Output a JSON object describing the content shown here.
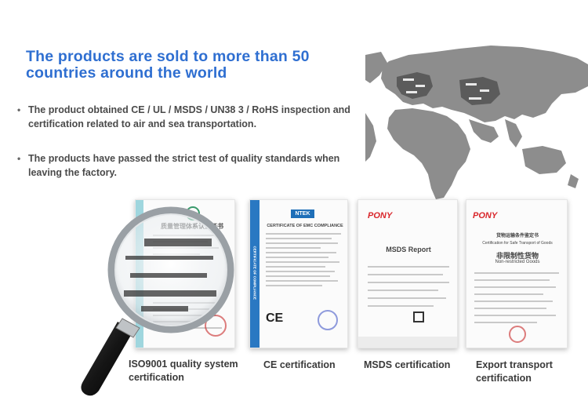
{
  "headline": "The products are sold to more than 50 countries around the world",
  "bullets": [
    "The product obtained CE / UL / MSDS / UN38 3 / RoHS inspection and certification related to air and sea transportation.",
    "The products have passed the strict test of quality standards when leaving the factory."
  ],
  "bullet_symbol": "•",
  "certificates": [
    {
      "caption": "ISO9001 quality system certification",
      "doc_title": "质量管理体系认证证书",
      "doc_lines": [
        "科技有限公司",
        "注册地址：",
        "代码: 9144030005276516",
        "质量管理体系符合",
        "1-2008 idt ISO9001: 2008 标准",
        "证书覆盖范",
        "：惠子电池的生产"
      ]
    },
    {
      "caption": "CE certification",
      "brand": "NTEK",
      "doc_title": "CERTIFICATE OF EMC COMPLIANCE",
      "side_label": "CERTIFICATE OF COMPLIANCE"
    },
    {
      "caption": "MSDS certification",
      "brand": "PONY",
      "doc_title": "MSDS   Report"
    },
    {
      "caption": "Export transport certification",
      "brand": "PONY",
      "doc_title": "货物运输条件鉴定书",
      "doc_subtitle": "Certification for Safe Transport of Goods",
      "doc_heading": "非限制性货物",
      "doc_heading_en": "Non-restricted Goods"
    }
  ],
  "colors": {
    "headline": "#2f6fd1",
    "map_land": "#8d8d8d",
    "map_highlight": "#5b5b5b",
    "pony_red": "#d9262b",
    "ntek_blue": "#1f6fb8"
  },
  "icons": [
    "world-map-icon",
    "magnifying-glass-icon",
    "ce-mark-icon"
  ]
}
